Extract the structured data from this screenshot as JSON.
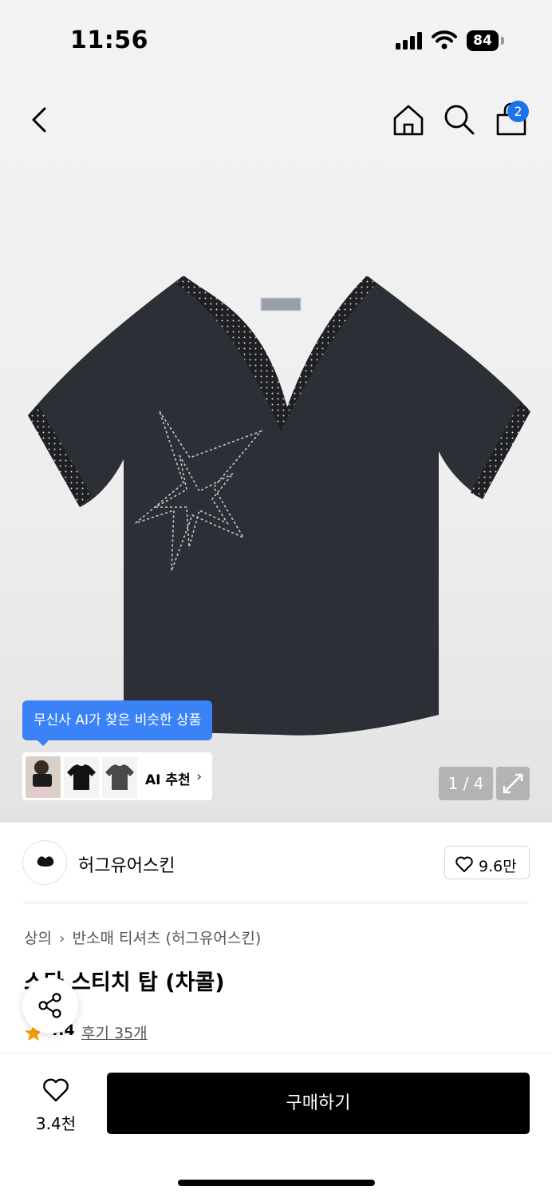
{
  "status_bar": {
    "time": "11:56",
    "battery_level": "84"
  },
  "nav": {
    "cart_count": "2"
  },
  "gallery": {
    "ai_tooltip": "무신사 AI가 찾은 비슷한 상품",
    "ai_recommend_label": "AI 추천",
    "ai_chevron": "›",
    "page_counter": "1 / 4",
    "thumbnails": [
      "model-photo",
      "black-tee",
      "charcoal-tee"
    ]
  },
  "brand": {
    "name": "허그유어스킨",
    "like_count": "9.6만"
  },
  "product": {
    "breadcrumb": [
      "상의",
      "반소매 티셔츠 (허그유어스킨)"
    ],
    "breadcrumb_separator": "›",
    "title": "스타 스티치 탑 (차콜)",
    "rating": "4.4",
    "review_label": "후기 35개"
  },
  "bottom_bar": {
    "wish_count": "3.4천",
    "buy_label": "구매하기"
  },
  "colors": {
    "accent_blue": "#3b82f6",
    "badge_blue": "#1a73e8",
    "star": "#f59e0b",
    "buy_button": "#000000"
  },
  "icons": [
    "back-arrow-icon",
    "home-icon",
    "search-icon",
    "shopping-bag-icon",
    "expand-icon",
    "heart-icon",
    "share-icon",
    "star-icon"
  ]
}
